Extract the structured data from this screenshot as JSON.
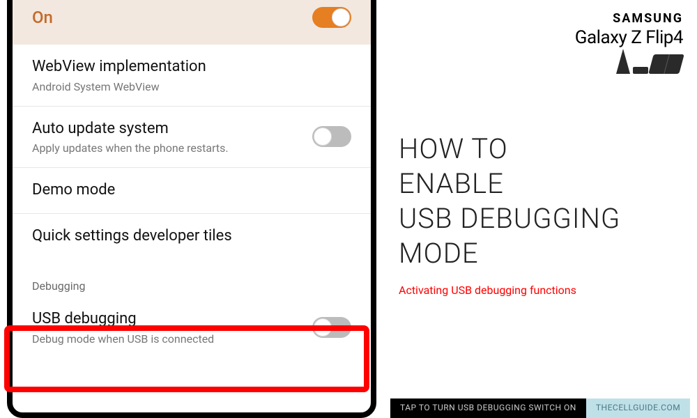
{
  "header": {
    "on_label": "On",
    "on_state": true
  },
  "items": {
    "webview": {
      "title": "WebView implementation",
      "sub": "Android System WebView"
    },
    "autoupdate": {
      "title": "Auto update system",
      "sub": "Apply updates when the phone restarts.",
      "state": false
    },
    "demo": {
      "title": "Demo mode"
    },
    "qstiles": {
      "title": "Quick settings developer tiles"
    },
    "section_debugging": "Debugging",
    "usbdebug": {
      "title": "USB debugging",
      "sub": "Debug mode when USB is connected",
      "state": false
    }
  },
  "branding": {
    "maker": "SAMSUNG",
    "model": "Galaxy Z Flip4"
  },
  "tutorial": {
    "headline_l1": "HOW TO",
    "headline_l2": "ENABLE",
    "headline_l3": "USB DEBUGGING",
    "headline_l4": "MODE",
    "subtitle": "Activating USB debugging functions"
  },
  "footer": {
    "caption": "TAP TO TURN USB DEBUGGING SWITCH ON",
    "credit": "THECELLGUIDE.COM"
  }
}
